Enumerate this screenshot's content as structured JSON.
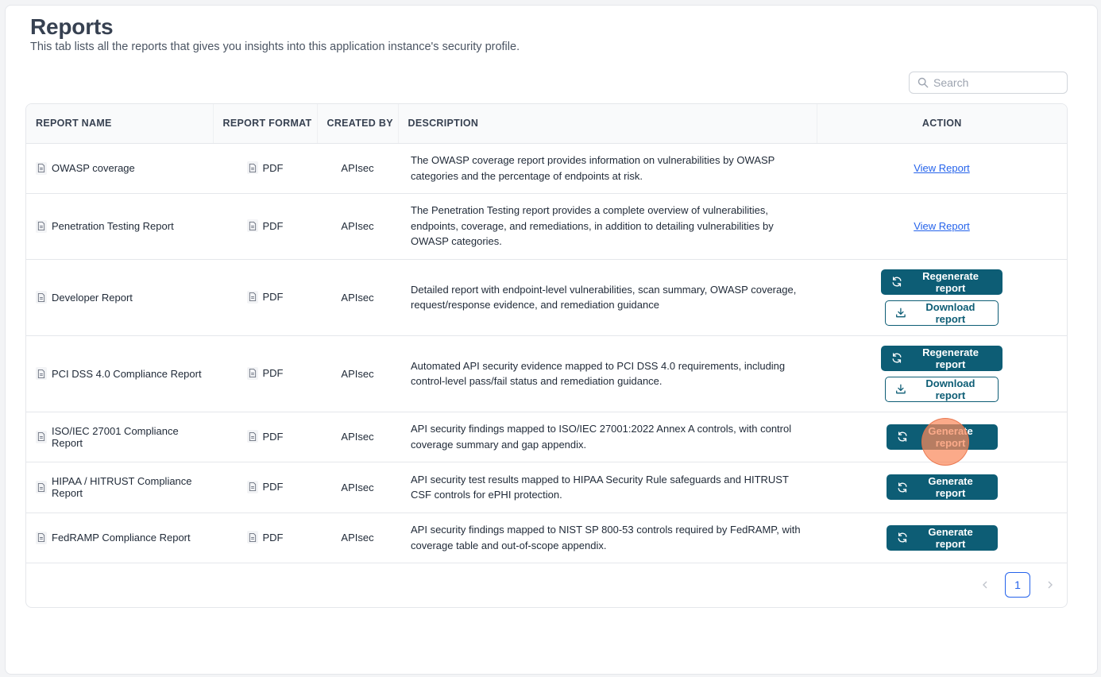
{
  "header": {
    "title": "Reports",
    "subtitle": "This tab lists all the reports that gives you insights into this application instance's security profile."
  },
  "search": {
    "placeholder": "Search",
    "value": ""
  },
  "table": {
    "columns": [
      "REPORT NAME",
      "REPORT FORMAT",
      "CREATED BY",
      "DESCRIPTION",
      "ACTION"
    ],
    "rows": [
      {
        "name": "OWASP coverage",
        "format": "PDF",
        "created_by": "APIsec",
        "description": "The OWASP coverage report provides information on vulnerabilities by OWASP categories and the percentage of endpoints at risk.",
        "action": "view",
        "action_label": "View Report"
      },
      {
        "name": "Penetration Testing Report",
        "format": "PDF",
        "created_by": "APIsec",
        "description": "The Penetration Testing report provides a complete overview of vulnerabilities, endpoints, coverage, and remediations, in addition to detailing vulnerabilities by OWASP categories.",
        "action": "view",
        "action_label": "View Report"
      },
      {
        "name": "Developer Report",
        "format": "PDF",
        "created_by": "APIsec",
        "description": "Detailed report with endpoint-level vulnerabilities, scan summary, OWASP coverage, request/response evidence, and remediation guidance",
        "action": "regenerate",
        "action_label": "Regenerate report",
        "secondary_label": "Download report"
      },
      {
        "name": "PCI DSS 4.0 Compliance Report",
        "format": "PDF",
        "created_by": "APIsec",
        "description": "Automated API security evidence mapped to PCI DSS 4.0 requirements, including control-level pass/fail status and remediation guidance.",
        "action": "regenerate",
        "action_label": "Regenerate report",
        "secondary_label": "Download report"
      },
      {
        "name": "ISO/IEC 27001 Compliance Report",
        "format": "PDF",
        "created_by": "APIsec",
        "description": "API security findings mapped to ISO/IEC 27001:2022 Annex A controls, with control coverage summary and gap appendix.",
        "action": "generate",
        "action_label": "Generate report"
      },
      {
        "name": "HIPAA / HITRUST Compliance Report",
        "format": "PDF",
        "created_by": "APIsec",
        "description": "API security test results mapped to HIPAA Security Rule safeguards and HITRUST CSF controls for ePHI protection.",
        "action": "generate",
        "action_label": "Generate report"
      },
      {
        "name": "FedRAMP Compliance Report",
        "format": "PDF",
        "created_by": "APIsec",
        "description": "API security findings mapped to NIST SP 800-53 controls required by FedRAMP, with coverage table and out-of-scope appendix.",
        "action": "generate",
        "action_label": "Generate report"
      }
    ]
  },
  "pagination": {
    "current_page": "1"
  },
  "colors": {
    "primary": "#0d5d75",
    "link": "#2563eb",
    "click_marker": "#f9895c"
  },
  "icons": {
    "search": "search-icon",
    "document": "document-icon",
    "refresh": "refresh-icon",
    "download": "download-icon",
    "prev": "chevron-left-icon",
    "next": "chevron-right-icon"
  }
}
